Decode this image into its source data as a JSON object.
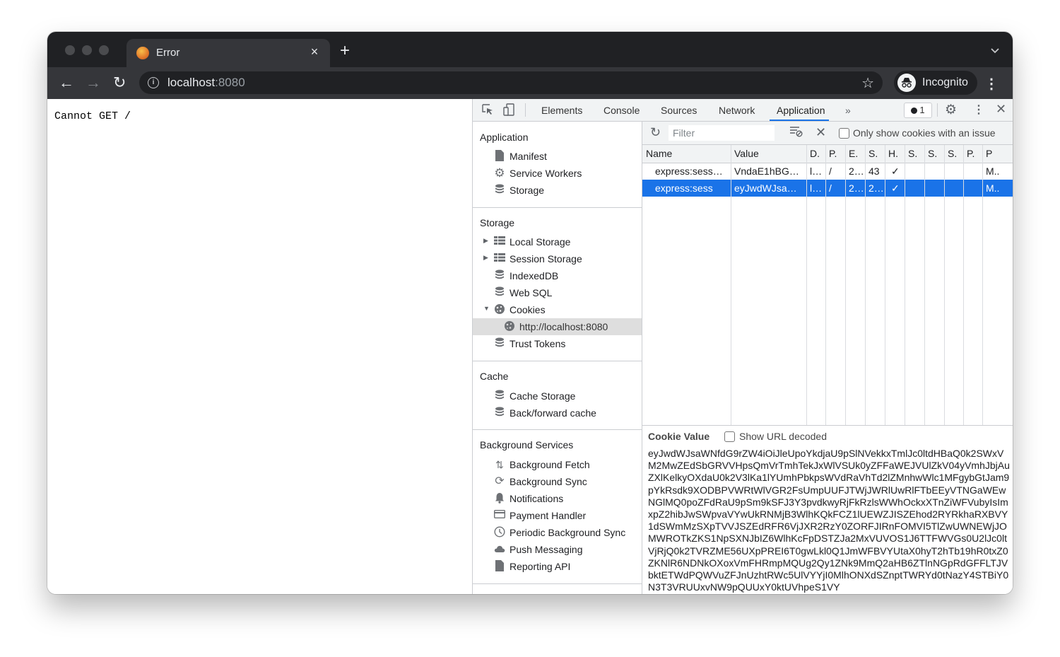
{
  "browser": {
    "tab_title": "Error",
    "tab_close": "×",
    "new_tab": "+",
    "tab_list_menu": "⌄",
    "url_host": "localhost",
    "url_port": ":8080",
    "profile_label": "Incognito"
  },
  "page": {
    "body_text": "Cannot GET /"
  },
  "devtools": {
    "tabs": [
      "Elements",
      "Console",
      "Sources",
      "Network",
      "Application"
    ],
    "active_tab": "Application",
    "more_tabs": "»",
    "issues_count": "1",
    "sidebar": {
      "application": {
        "title": "Application",
        "items": [
          "Manifest",
          "Service Workers",
          "Storage"
        ]
      },
      "storage": {
        "title": "Storage",
        "items": [
          "Local Storage",
          "Session Storage",
          "IndexedDB",
          "Web SQL",
          "Cookies",
          "http://localhost:8080",
          "Trust Tokens"
        ]
      },
      "cache": {
        "title": "Cache",
        "items": [
          "Cache Storage",
          "Back/forward cache"
        ]
      },
      "background_services": {
        "title": "Background Services",
        "items": [
          "Background Fetch",
          "Background Sync",
          "Notifications",
          "Payment Handler",
          "Periodic Background Sync",
          "Push Messaging",
          "Reporting API"
        ]
      }
    },
    "cookies": {
      "filter_placeholder": "Filter",
      "only_issues_label": "Only show cookies with an issue",
      "columns": [
        "Name",
        "Value",
        "D.",
        "P.",
        "E.",
        "S.",
        "H.",
        "S.",
        "S.",
        "S.",
        "P.",
        "P"
      ],
      "rows": [
        {
          "cells": [
            "express:sess…",
            "VndaE1hBG…",
            "l…",
            "/",
            "2…",
            "43",
            "✓",
            "",
            "",
            "",
            "",
            "M.."
          ],
          "selected": false
        },
        {
          "cells": [
            "express:sess",
            "eyJwdWJsa…",
            "l…",
            "/",
            "2…",
            "2…",
            "✓",
            "",
            "",
            "",
            "",
            "M.."
          ],
          "selected": true
        }
      ],
      "value_pane": {
        "title": "Cookie Value",
        "show_decoded_label": "Show URL decoded",
        "value": "eyJwdWJsaWNfdG9rZW4iOiJleUpoYkdjaU9pSlNVekkxTmlJc0ltdHBaQ0k2SWxVM2MwZEdSbGRVVHpsQmVrTmhTekJxWlVSUk0yZFFaWEJVUlZkV04yVmhJbjAuZXlKelkyOXdaU0k2V3lKa1lYUmhPbkpsWVdRaVhTd2lZMnhwWlc1MFgybGtJam9pYkRsdk9XODBPVWRtWlVGR2FsUmpUUFJTWjJWRlUwRlFTbEEyVTNGaWEwNGlMQ0poZFdRaU9pSm9kSFJ3Y3pvdkwyRjFkRzlsWWhOckxXTnZiWFVubyIsImxpZ2hibJwSWpvaVYwUkRNMjB3WlhKQkFCZ1lUEWZJISZEhod2RYRkhaRXBVY1dSWmMzSXpTVVJSZEdRFR6VjJXR2RzY0ZORFJIRnFOMVI5TlZwUWNEWjJOMWROTkZKS1NpSXNJbIZ6WlhKcFpDSTZJa2MxVUVOS1J6TTFWVGs0U2lJc0ltVjRjQ0k2TVRZME56UXpPREI6T0gwLkl0Q1JmWFBVYUtaX0hyT2hTb19hR0txZ0ZKNlR6NDNkOXoxVmFHRmpMQUg2Qy1ZNk9MmQ2aHB6ZTlnNGpRdGFFLTJVbktETWdPQWVuZFJnUzhtRWc5UlVYYjI0MlhONXdSZnptTWRYd0tNazY4STBiY0N3T3VRUUxvNW9pQUUxY0ktUVhpeS1VY"
      }
    }
  }
}
